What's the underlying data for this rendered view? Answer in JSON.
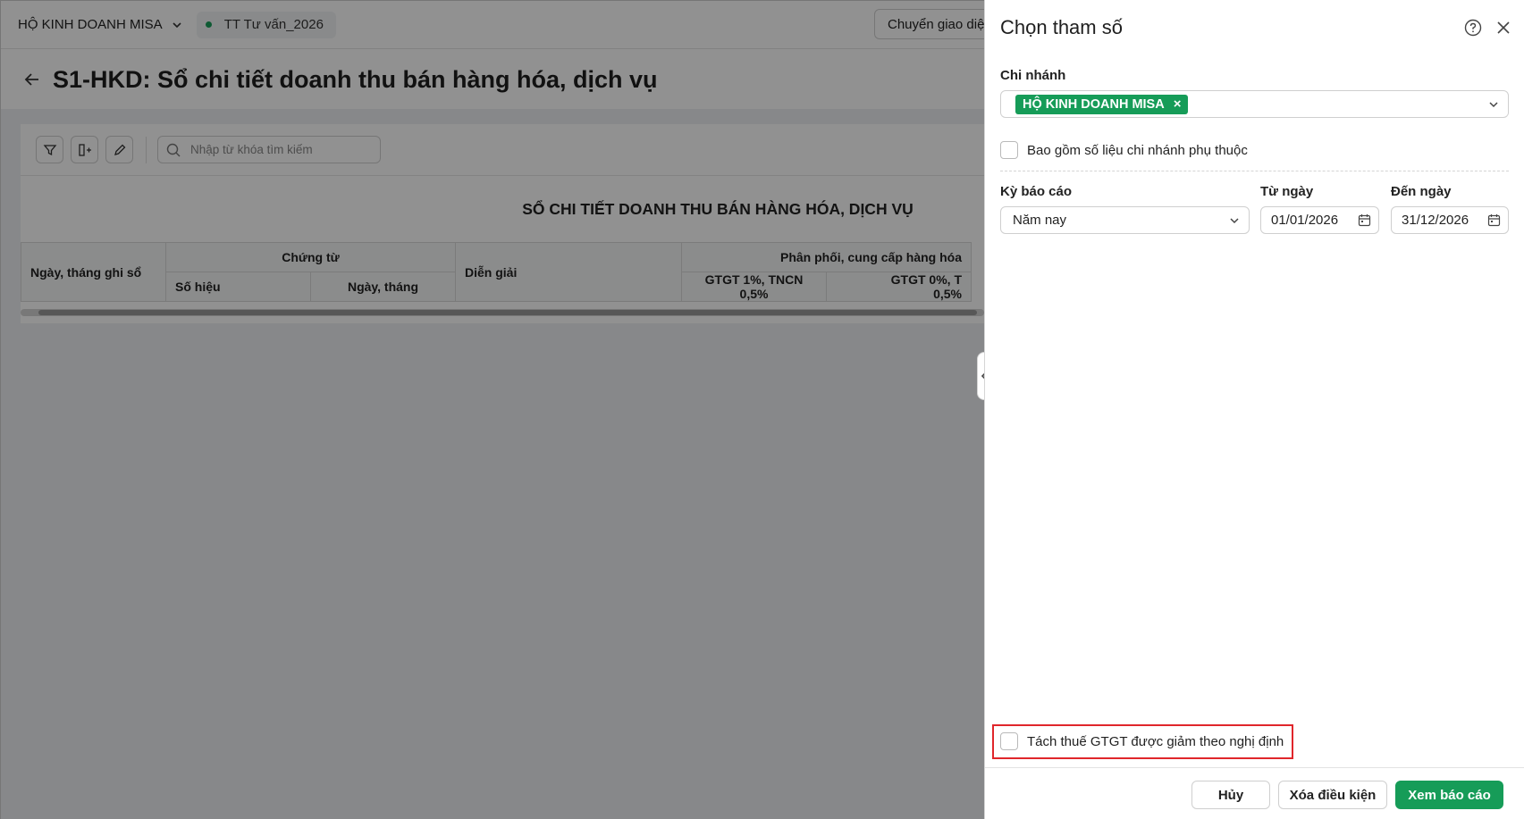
{
  "topbar": {
    "company": "HỘ KINH DOANH MISA",
    "workspace": "TT Tư vấn_2026",
    "switch_button": "Chuyển giao diện"
  },
  "page": {
    "title": "S1-HKD: Sổ chi tiết doanh thu bán hàng hóa, dịch vụ"
  },
  "toolbar": {
    "search_placeholder": "Nhập từ khóa tìm kiếm"
  },
  "report": {
    "title": "SỔ CHI TIẾT DOANH THU BÁN HÀNG HÓA, DỊCH VỤ",
    "columns": {
      "date_recorded": "Ngày, tháng ghi sổ",
      "voucher": "Chứng từ",
      "voucher_no": "Số hiệu",
      "voucher_date": "Ngày, tháng",
      "description": "Diễn giải",
      "distribution": "Phân phối, cung cấp hàng hóa",
      "vat1_a": "GTGT 1%, TNCN",
      "vat1_b": "0,5%",
      "vat0_a": "GTGT 0%, T",
      "vat0_b": "0,5%"
    }
  },
  "panel": {
    "title": "Chọn tham số",
    "branch_label": "Chi nhánh",
    "branch_tag": "HỘ KINH DOANH MISA",
    "include_dependent": "Bao gồm số liệu chi nhánh phụ thuộc",
    "period_label": "Kỳ báo cáo",
    "period_value": "Năm nay",
    "from_label": "Từ ngày",
    "from_value": "01/01/2026",
    "to_label": "Đến ngày",
    "to_value": "31/12/2026",
    "separate_vat": "Tách thuế GTGT được giảm theo nghị định",
    "cancel": "Hủy",
    "clear": "Xóa điều kiện",
    "view": "Xem báo cáo"
  },
  "colors": {
    "accent": "#169c58",
    "highlight": "#e0262b"
  }
}
